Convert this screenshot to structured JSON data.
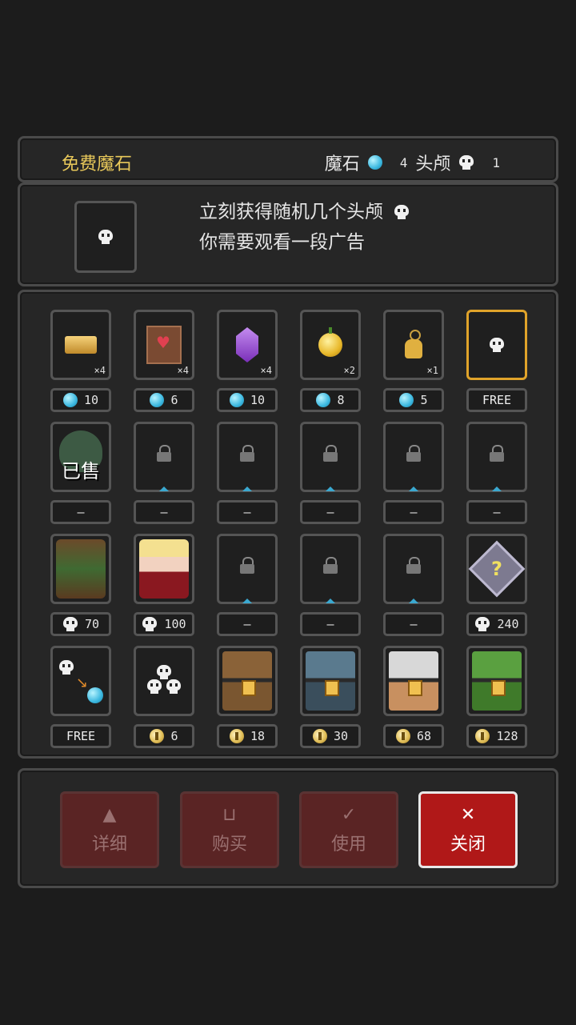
{
  "header": {
    "title": "免费魔石",
    "gem_label": "魔石",
    "gem_count": "4",
    "skull_label": "头颅",
    "skull_count": "1"
  },
  "offer": {
    "line1": "立刻获得随机几个头颅",
    "line2": "你需要观看一段广告"
  },
  "grid": {
    "row1": [
      {
        "name": "gold-bars",
        "qty": "×4",
        "currency": "gem",
        "price": "10"
      },
      {
        "name": "love-scroll",
        "qty": "×4",
        "currency": "gem",
        "price": "6"
      },
      {
        "name": "purple-crystal",
        "qty": "×4",
        "currency": "gem",
        "price": "10"
      },
      {
        "name": "golden-apple",
        "qty": "×2",
        "currency": "gem",
        "price": "8"
      },
      {
        "name": "skull-amulet",
        "qty": "×1",
        "currency": "gem",
        "price": "5"
      },
      {
        "name": "skull-ad",
        "qty": "",
        "currency": "none",
        "price": "FREE"
      }
    ],
    "row2": [
      {
        "name": "sold-slime",
        "sold_label": "已售",
        "price": "—"
      },
      {
        "name": "locked",
        "price": "—"
      },
      {
        "name": "locked",
        "price": "—"
      },
      {
        "name": "locked",
        "price": "—"
      },
      {
        "name": "locked",
        "price": "—"
      },
      {
        "name": "locked",
        "price": "—"
      }
    ],
    "row3": [
      {
        "name": "treant-hero",
        "currency": "skull",
        "price": "70"
      },
      {
        "name": "vampire-girl-hero",
        "currency": "skull",
        "price": "100"
      },
      {
        "name": "locked",
        "price": "—"
      },
      {
        "name": "locked",
        "price": "—"
      },
      {
        "name": "locked",
        "price": "—"
      },
      {
        "name": "mystery-box",
        "mystery_symbol": "?",
        "currency": "skull",
        "price": "240"
      }
    ],
    "row4": [
      {
        "name": "skull-to-gem",
        "currency": "none",
        "price": "FREE"
      },
      {
        "name": "triple-skull",
        "currency": "coin",
        "price": "6"
      },
      {
        "name": "brown-chest",
        "currency": "coin",
        "price": "18"
      },
      {
        "name": "blue-chest",
        "currency": "coin",
        "price": "30"
      },
      {
        "name": "silver-chest",
        "currency": "coin",
        "price": "68"
      },
      {
        "name": "green-chest",
        "currency": "coin",
        "price": "128"
      }
    ]
  },
  "actions": {
    "details": "详细",
    "buy": "购买",
    "use": "使用",
    "close": "关闭",
    "close_icon": "✕",
    "use_icon": "✓"
  },
  "colors": {
    "accent": "#e0a32a",
    "gem": "#3bb8e0",
    "close_red": "#b01818"
  }
}
